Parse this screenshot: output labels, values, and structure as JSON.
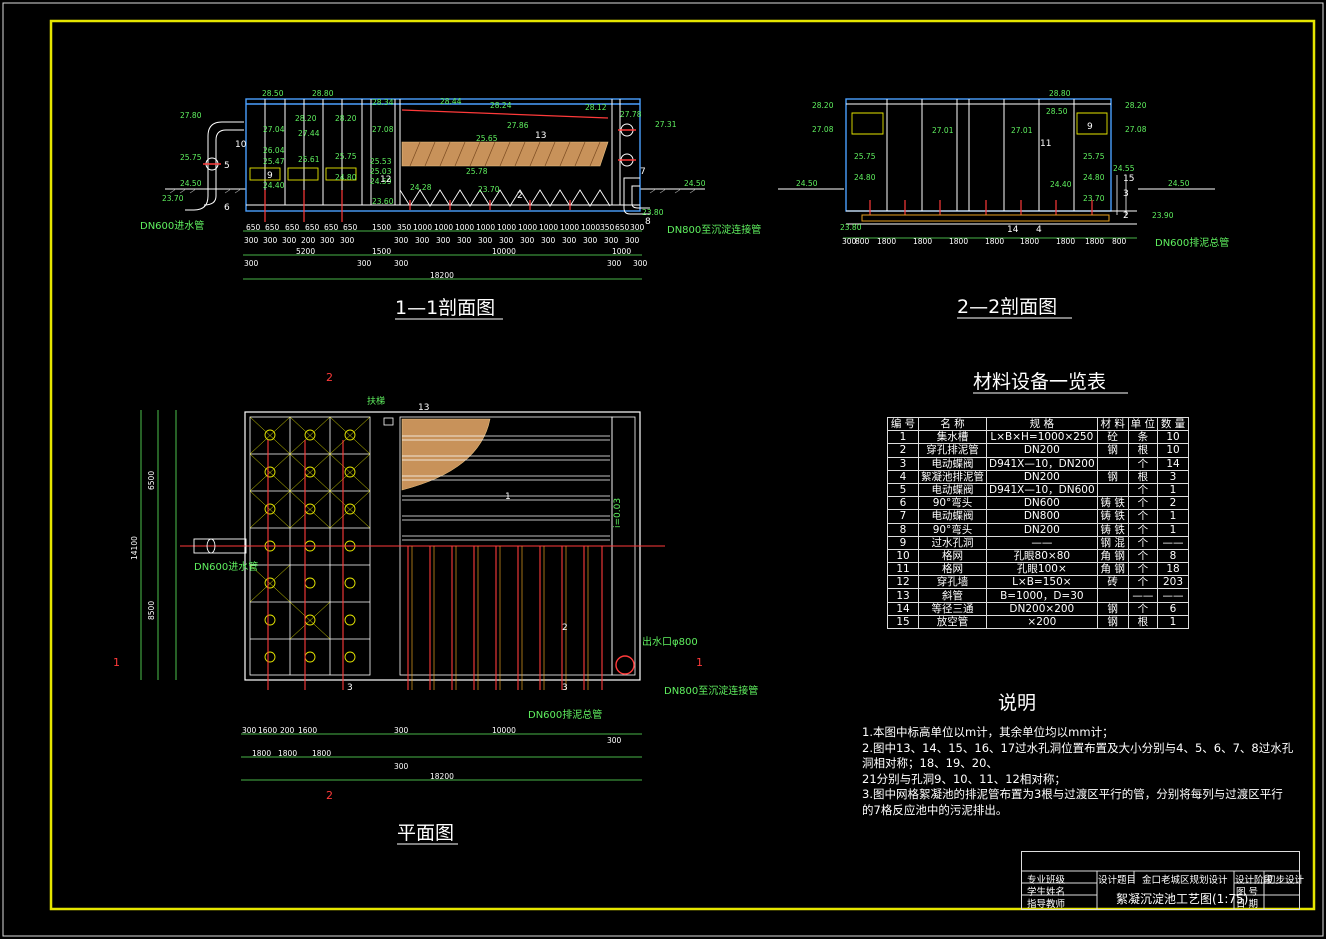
{
  "drawing": {
    "section1_title": "1—1剖面图",
    "section2_title": "2—2剖面图",
    "plan_title": "平面图",
    "section1": {
      "elevations": [
        "28.50",
        "28.80",
        "27.80",
        "28.20",
        "28.20",
        "28.34",
        "28.44",
        "28.24",
        "28.12",
        "27.78",
        "27.31",
        "27.04",
        "27.44",
        "27.08",
        "27.86",
        "25.65",
        "26.04",
        "25.47",
        "25.61",
        "25.75",
        "25.53",
        "25.75",
        "25.03",
        "25.78",
        "24.50",
        "24.40",
        "24.80",
        "24.59",
        "24.28",
        "23.70",
        "24.50",
        "23.70",
        "23.60",
        "23.80"
      ],
      "pipe_in": "DN600进水管",
      "pipe_out": "DN800至沉淀连接管",
      "dims_row1": [
        "650",
        "650",
        "650",
        "650",
        "650",
        "650",
        "1500",
        "350",
        "1000",
        "1000",
        "1000",
        "1000",
        "1000",
        "1000",
        "1000",
        "1000",
        "1000",
        "350",
        "650",
        "300"
      ],
      "dims_row2": [
        "300",
        "300",
        "300",
        "200",
        "300",
        "300",
        "300",
        "300",
        "300",
        "300",
        "300",
        "300",
        "300",
        "300",
        "300",
        "300",
        "300",
        "300",
        "300",
        "300",
        "300",
        "300",
        "300",
        "300",
        "300"
      ],
      "dim_5200": "5200",
      "dim_1500": "1500",
      "dim_10000": "10000",
      "dim_1000": "1000",
      "dim_300": "300",
      "dim_18200": "18200",
      "labels": [
        "10",
        "5",
        "6",
        "9",
        "12",
        "13",
        "2",
        "7",
        "8"
      ]
    },
    "section2": {
      "elevations": [
        "28.20",
        "28.80",
        "28.50",
        "28.20",
        "27.08",
        "27.01",
        "27.01",
        "27.08",
        "25.75",
        "25.75",
        "24.80",
        "24.40",
        "24.80",
        "24.55",
        "24.50",
        "24.50",
        "23.70",
        "23.80",
        "23.90"
      ],
      "pipe": "DN600排泥总管",
      "dims": [
        "300",
        "800",
        "1800",
        "1800",
        "1800",
        "1800",
        "1800",
        "1800",
        "1800",
        "800",
        "800"
      ],
      "labels": [
        "9",
        "11",
        "15",
        "14",
        "4",
        "3",
        "2"
      ]
    },
    "plan": {
      "pipe_in": "DN600进水管",
      "pipe_out": "DN800至沉淀连接管",
      "outlet": "出水口φ800",
      "sludge": "DN600排泥总管",
      "stairs": "扶梯",
      "slope": "i=0.03",
      "section_marks": [
        "2",
        "2",
        "1",
        "1"
      ],
      "left_dims": [
        "6500",
        "14100",
        "8500"
      ],
      "bottom_dims": [
        "300",
        "1600",
        "200",
        "1600",
        "300",
        "1800",
        "1800",
        "1800",
        "300",
        "10000",
        "300",
        "18200"
      ],
      "labels": [
        "13",
        "1",
        "2",
        "3",
        "3"
      ]
    },
    "table": {
      "title": "材料设备一览表",
      "headers": [
        "编 号",
        "名 称",
        "规 格",
        "材 料",
        "单 位",
        "数 量"
      ],
      "rows": [
        [
          "1",
          "集水槽",
          "L×B×H=1000×250",
          "砼",
          "条",
          "10"
        ],
        [
          "2",
          "穿孔排泥管",
          "DN200",
          "钢",
          "根",
          "10"
        ],
        [
          "3",
          "电动蝶阀",
          "D941X—10，DN200",
          "",
          "个",
          "14"
        ],
        [
          "4",
          "絮凝池排泥管",
          "DN200",
          "钢",
          "根",
          "3"
        ],
        [
          "5",
          "电动蝶阀",
          "D941X—10，DN600",
          "",
          "个",
          "1"
        ],
        [
          "6",
          "90°弯头",
          "DN600",
          "铸 铁",
          "个",
          "2"
        ],
        [
          "7",
          "电动蝶阀",
          "DN800",
          "铸 铁",
          "个",
          "1"
        ],
        [
          "8",
          "90°弯头",
          "DN200",
          "铸 铁",
          "个",
          "1"
        ],
        [
          "9",
          "过水孔洞",
          "——",
          "钢 混",
          "个",
          "——"
        ],
        [
          "10",
          "格网",
          "孔眼80×80",
          "角 钢",
          "个",
          "8"
        ],
        [
          "11",
          "格网",
          "孔眼100×",
          "角 钢",
          "个",
          "18"
        ],
        [
          "12",
          "穿孔墙",
          "L×B=150×",
          "砖",
          "个",
          "203"
        ],
        [
          "13",
          "斜管",
          "B=1000，D=30",
          "",
          "——",
          "——"
        ],
        [
          "14",
          "等径三通",
          "DN200×200",
          "钢",
          "个",
          "6"
        ],
        [
          "15",
          "放空管",
          "×200",
          "钢",
          "根",
          "1"
        ]
      ]
    },
    "notes": {
      "title": "说明",
      "lines": [
        "1.本图中标高单位以m计，其余单位均以mm计；",
        "2.图中13、14、15、16、17过水孔洞位置布置及大小分别与4、5、6、7、8过水孔",
        "洞相对称；18、19、20、",
        "21分别与孔洞9、10、11、12相对称；",
        "3.图中网格絮凝池的排泥管布置为3根与过渡区平行的管，分别将每列与过渡区平行",
        "的7格反应池中的污泥排出。"
      ]
    },
    "title_block": {
      "major_class": "专业班级",
      "student": "学生姓名",
      "teacher": "指导教师",
      "project_label": "设计题目",
      "project": "金口老城区规划设计",
      "stage_label": "设计阶段",
      "stage": "初步设计",
      "drawing_name": "絮凝沉淀池工艺图(1:75)",
      "sheet_label": "图 号",
      "date_label": "日 期"
    }
  }
}
